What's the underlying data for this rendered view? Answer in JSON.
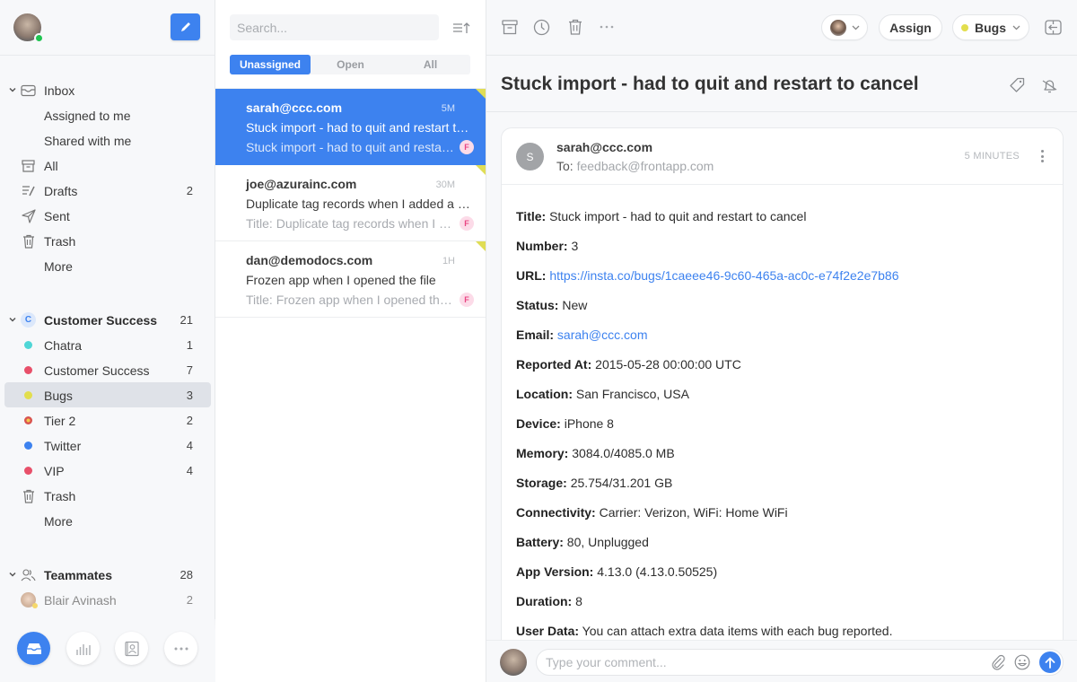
{
  "sidebar": {
    "compose_label": "Compose",
    "inbox_section": {
      "label": "Inbox",
      "items": [
        {
          "label": "Assigned to me",
          "count": ""
        },
        {
          "label": "Shared with me",
          "count": ""
        },
        {
          "label": "All",
          "count": "",
          "icon": "archive-icon"
        },
        {
          "label": "Drafts",
          "count": "2",
          "icon": "drafts-icon"
        },
        {
          "label": "Sent",
          "count": "",
          "icon": "send-icon"
        },
        {
          "label": "Trash",
          "count": "",
          "icon": "trash-icon"
        },
        {
          "label": "More",
          "count": ""
        }
      ]
    },
    "team_section": {
      "badge": "C",
      "label": "Customer Success",
      "count": "21",
      "items": [
        {
          "label": "Chatra",
          "count": "1",
          "color": "#4fd6d6"
        },
        {
          "label": "Customer Success",
          "count": "7",
          "color": "#e8506a"
        },
        {
          "label": "Bugs",
          "count": "3",
          "color": "#e2de4d",
          "selected": true
        },
        {
          "label": "Tier 2",
          "count": "2",
          "color": "#d9534f"
        },
        {
          "label": "Twitter",
          "count": "4",
          "color": "#3d82ef"
        },
        {
          "label": "VIP",
          "count": "4",
          "color": "#e8506a"
        },
        {
          "label": "Trash",
          "count": ""
        },
        {
          "label": "More",
          "count": ""
        }
      ]
    },
    "teammates_section": {
      "label": "Teammates",
      "count": "28",
      "items": [
        {
          "label": "Blair Avinash",
          "count": "2"
        }
      ]
    },
    "bottom_nav": [
      "inbox",
      "analytics",
      "contacts",
      "more"
    ]
  },
  "list": {
    "search_placeholder": "Search...",
    "tabs": [
      {
        "label": "Unassigned",
        "active": true
      },
      {
        "label": "Open",
        "active": false
      },
      {
        "label": "All",
        "active": false
      }
    ],
    "conversations": [
      {
        "from": "sarah@ccc.com",
        "time": "5M",
        "subject": "Stuck import - had to quit and restart to cancel",
        "preview": "Stuck import - had to quit and restart to cancel",
        "badge": "F",
        "selected": true
      },
      {
        "from": "joe@azurainc.com",
        "time": "30M",
        "subject": "Duplicate tag records when I added a new tag",
        "preview": "Title: Duplicate tag records when I added a new tag",
        "badge": "F",
        "selected": false
      },
      {
        "from": "dan@demodocs.com",
        "time": "1H",
        "subject": "Frozen app when I opened the file",
        "preview": "Title: Frozen app when I opened the file",
        "badge": "F",
        "selected": false
      }
    ]
  },
  "main": {
    "toolbar": {
      "assign_label": "Assign",
      "tag_label": "Bugs",
      "tag_color": "#e2de4d"
    },
    "subject": "Stuck import - had to quit and restart to cancel",
    "message": {
      "avatar_letter": "S",
      "from": "sarah@ccc.com",
      "to_label": "To:",
      "to": "feedback@frontapp.com",
      "time": "5 MINUTES",
      "fields": [
        {
          "key": "Title:",
          "value": "Stuck import - had to quit and restart to cancel"
        },
        {
          "key": "Number:",
          "value": "3"
        },
        {
          "key": "URL:",
          "value": "https://insta.co/bugs/1caeee46-9c60-465a-ac0c-e74f2e2e7b86",
          "link": true
        },
        {
          "key": "Status:",
          "value": "New"
        },
        {
          "key": "Email:",
          "value": "sarah@ccc.com",
          "link": true
        },
        {
          "key": "Reported At:",
          "value": "2015-05-28 00:00:00 UTC"
        },
        {
          "key": "Location:",
          "value": "San Francisco, USA"
        },
        {
          "key": "Device:",
          "value": "iPhone 8"
        },
        {
          "key": "Memory:",
          "value": "3084.0/4085.0 MB"
        },
        {
          "key": "Storage:",
          "value": "25.754/31.201 GB"
        },
        {
          "key": "Connectivity:",
          "value": "Carrier: Verizon, WiFi: Home WiFi"
        },
        {
          "key": "Battery:",
          "value": "80, Unplugged"
        },
        {
          "key": "App Version:",
          "value": "4.13.0 (4.13.0.50525)"
        },
        {
          "key": "Duration:",
          "value": "8"
        },
        {
          "key": "User Data:",
          "value": "You can attach extra data items with each bug reported."
        }
      ]
    },
    "composer": {
      "placeholder": "Type your comment..."
    }
  },
  "colors": {
    "accent": "#3d82ef",
    "online": "#1fc451",
    "flag": "#e0dd55"
  }
}
